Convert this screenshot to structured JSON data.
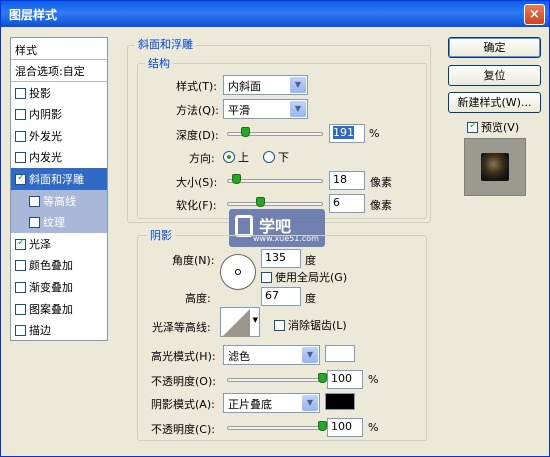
{
  "window": {
    "title": "图层样式",
    "close_glyph": "×"
  },
  "styles_panel": {
    "header": "样式",
    "blend_options": "混合选项:自定",
    "items": [
      {
        "label": "投影",
        "checked": false
      },
      {
        "label": "内阴影",
        "checked": false
      },
      {
        "label": "外发光",
        "checked": false
      },
      {
        "label": "内发光",
        "checked": false
      },
      {
        "label": "斜面和浮雕",
        "checked": true,
        "selected": true
      },
      {
        "label": "等高线",
        "checked": false,
        "sub": true
      },
      {
        "label": "纹理",
        "checked": false,
        "sub": true
      },
      {
        "label": "光泽",
        "checked": true
      },
      {
        "label": "颜色叠加",
        "checked": false
      },
      {
        "label": "渐变叠加",
        "checked": false
      },
      {
        "label": "图案叠加",
        "checked": false
      },
      {
        "label": "描边",
        "checked": false
      }
    ]
  },
  "bevel": {
    "section_title": "斜面和浮雕",
    "structure_title": "结构",
    "style_label": "样式(T):",
    "style_value": "内斜面",
    "method_label": "方法(Q):",
    "method_value": "平滑",
    "depth_label": "深度(D):",
    "depth_value": "191",
    "depth_unit": "%",
    "depth_slider_fraction": 0.2,
    "direction_label": "方向:",
    "direction_up": "上",
    "direction_down": "下",
    "direction_selected": "上",
    "size_label": "大小(S):",
    "size_value": "18",
    "size_unit": "像素",
    "size_slider_fraction": 0.1,
    "soften_label": "软化(F):",
    "soften_value": "6",
    "soften_unit": "像素",
    "soften_slider_fraction": 0.35
  },
  "shading": {
    "title": "阴影",
    "angle_label": "角度(N):",
    "angle_value": "135",
    "angle_unit": "度",
    "global_light_label": "使用全局光(G)",
    "global_light_checked": false,
    "altitude_label": "高度:",
    "altitude_value": "67",
    "altitude_unit": "度",
    "gloss_contour_label": "光泽等高线:",
    "antialias_label": "消除锯齿(L)",
    "antialias_checked": false,
    "highlight_mode_label": "高光模式(H):",
    "highlight_mode_value": "滤色",
    "highlight_color": "#ffffff",
    "highlight_opacity_label": "不透明度(O):",
    "highlight_opacity_value": "100",
    "highlight_opacity_unit": "%",
    "shadow_mode_label": "阴影模式(A):",
    "shadow_mode_value": "正片叠底",
    "shadow_color": "#000000",
    "shadow_opacity_label": "不透明度(C):",
    "shadow_opacity_value": "100",
    "shadow_opacity_unit": "%"
  },
  "buttons": {
    "ok": "确定",
    "reset": "复位",
    "new_style": "新建样式(W)...",
    "preview_label": "预览(V)",
    "preview_checked": true
  },
  "watermark": {
    "text": "学吧",
    "url": "www.xue51.com"
  }
}
